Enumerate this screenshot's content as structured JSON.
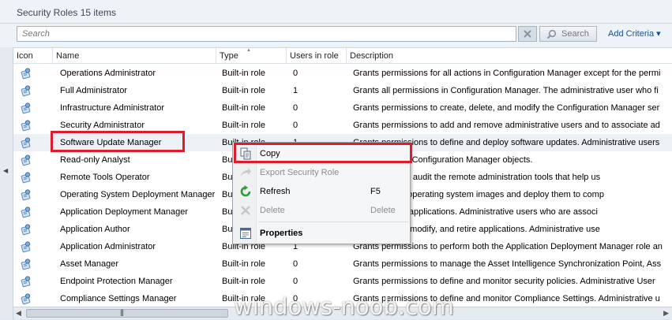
{
  "header": {
    "title": "Security Roles 15 items"
  },
  "search": {
    "placeholder": "Search",
    "button_label": "Search",
    "add_criteria_label": "Add Criteria ▾"
  },
  "columns": {
    "icon": "Icon",
    "name": "Name",
    "type": "Type",
    "users": "Users in role",
    "description": "Description"
  },
  "rows": [
    {
      "name": "Operations Administrator",
      "type": "Built-in role",
      "users": "0",
      "description": "Grants permissions for all actions in Configuration Manager except for the permi"
    },
    {
      "name": "Full Administrator",
      "type": "Built-in role",
      "users": "1",
      "description": "Grants all permissions in Configuration Manager. The administrative user who fi"
    },
    {
      "name": "Infrastructure Administrator",
      "type": "Built-in role",
      "users": "0",
      "description": "Grants permissions to create, delete, and modify the Configuration Manager ser"
    },
    {
      "name": "Security Administrator",
      "type": "Built-in role",
      "users": "0",
      "description": "Grants permissions to add and remove administrative users and to associate ad"
    },
    {
      "name": "Software Update Manager",
      "type": "Built-in role",
      "users": "1",
      "description": "Grants permissions to define and deploy software updates. Administrative users"
    },
    {
      "name": "Read-only Analyst",
      "type": "Bu",
      "users": "",
      "description": "ions to view all Configuration Manager objects."
    },
    {
      "name": "Remote Tools Operator",
      "type": "Bu",
      "users": "",
      "description": "ions to run and audit the remote administration tools that help us"
    },
    {
      "name": "Operating System Deployment Manager",
      "type": "Bu",
      "users": "",
      "description": "ions to create operating system images and deploy them to comp"
    },
    {
      "name": "Application Deployment Manager",
      "type": "Bu",
      "users": "",
      "description": "ions to deploy applications.  Administrative users who are associ"
    },
    {
      "name": "Application Author",
      "type": "Bu",
      "users": "",
      "description": "ions to create, modify, and retire applications. Administrative use"
    },
    {
      "name": "Application Administrator",
      "type": "Built-in role",
      "users": "1",
      "description": "Grants permissions to perform both the Application Deployment Manager role an"
    },
    {
      "name": "Asset Manager",
      "type": "Built-in role",
      "users": "0",
      "description": "Grants permissions to manage the Asset Intelligence Synchronization Point, Ass"
    },
    {
      "name": "Endpoint Protection Manager",
      "type": "Built-in role",
      "users": "0",
      "description": "Grants permissions to define and monitor security policies. Administrative User"
    },
    {
      "name": "Compliance Settings Manager",
      "type": "Built-in role",
      "users": "0",
      "description": "Grants permissions to define and monitor Compliance Settings. Administrative u"
    }
  ],
  "context_menu": {
    "copy": "Copy",
    "export": "Export Security Role",
    "refresh": "Refresh",
    "refresh_key": "F5",
    "delete": "Delete",
    "delete_key": "Delete",
    "properties": "Properties"
  },
  "watermark": "windows-noob.com",
  "colors": {
    "highlight": "#e01b2a",
    "link": "#1a4f8c"
  }
}
